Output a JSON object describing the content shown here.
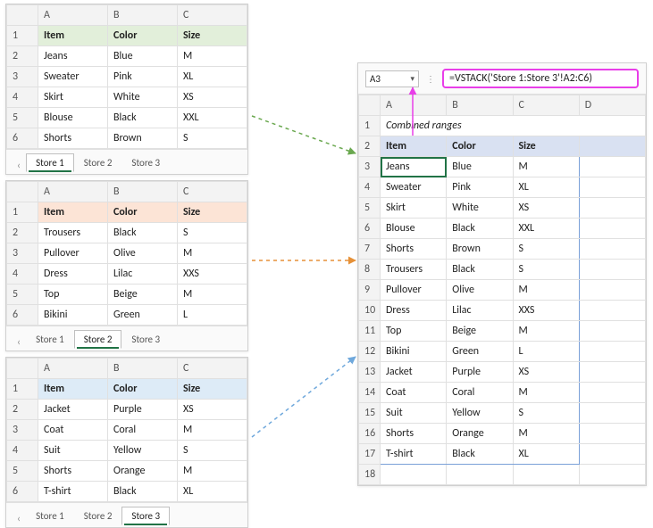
{
  "chart_data": {
    "type": "table",
    "formula": "=VSTACK('Store 1:Store 3'!A2:C6)",
    "active_cell": "A3",
    "columns": [
      "Item",
      "Color",
      "Size"
    ],
    "sheets": [
      {
        "name": "Store 1",
        "rows": [
          [
            "Jeans",
            "Blue",
            "M"
          ],
          [
            "Sweater",
            "Pink",
            "XL"
          ],
          [
            "Skirt",
            "White",
            "XS"
          ],
          [
            "Blouse",
            "Black",
            "XXL"
          ],
          [
            "Shorts",
            "Brown",
            "S"
          ]
        ]
      },
      {
        "name": "Store 2",
        "rows": [
          [
            "Trousers",
            "Black",
            "S"
          ],
          [
            "Pullover",
            "Olive",
            "M"
          ],
          [
            "Dress",
            "Lilac",
            "XXS"
          ],
          [
            "Top",
            "Beige",
            "M"
          ],
          [
            "Bikini",
            "Green",
            "L"
          ]
        ]
      },
      {
        "name": "Store 3",
        "rows": [
          [
            "Jacket",
            "Purple",
            "XS"
          ],
          [
            "Coat",
            "Coral",
            "M"
          ],
          [
            "Suit",
            "Yellow",
            "S"
          ],
          [
            "Shorts",
            "Orange",
            "M"
          ],
          [
            "T-shirt",
            "Black",
            "XL"
          ]
        ]
      }
    ],
    "combined_title": "Combined ranges",
    "combined_rows": [
      [
        "Jeans",
        "Blue",
        "M"
      ],
      [
        "Sweater",
        "Pink",
        "XL"
      ],
      [
        "Skirt",
        "White",
        "XS"
      ],
      [
        "Blouse",
        "Black",
        "XXL"
      ],
      [
        "Shorts",
        "Brown",
        "S"
      ],
      [
        "Trousers",
        "Black",
        "S"
      ],
      [
        "Pullover",
        "Olive",
        "M"
      ],
      [
        "Dress",
        "Lilac",
        "XXS"
      ],
      [
        "Top",
        "Beige",
        "M"
      ],
      [
        "Bikini",
        "Green",
        "L"
      ],
      [
        "Jacket",
        "Purple",
        "XS"
      ],
      [
        "Coat",
        "Coral",
        "M"
      ],
      [
        "Suit",
        "Yellow",
        "S"
      ],
      [
        "Shorts",
        "Orange",
        "M"
      ],
      [
        "T-shirt",
        "Black",
        "XL"
      ]
    ]
  },
  "p1": {
    "h_item": "Item",
    "h_color": "Color",
    "h_size": "Size",
    "r1c1": "Jeans",
    "r1c2": "Blue",
    "r1c3": "M",
    "r2c1": "Sweater",
    "r2c2": "Pink",
    "r2c3": "XL",
    "r3c1": "Skirt",
    "r3c2": "White",
    "r3c3": "XS",
    "r4c1": "Blouse",
    "r4c2": "Black",
    "r4c3": "XXL",
    "r5c1": "Shorts",
    "r5c2": "Brown",
    "r5c3": "S",
    "tab1": "Store 1",
    "tab2": "Store 2",
    "tab3": "Store 3"
  },
  "p2": {
    "h_item": "Item",
    "h_color": "Color",
    "h_size": "Size",
    "r1c1": "Trousers",
    "r1c2": "Black",
    "r1c3": "S",
    "r2c1": "Pullover",
    "r2c2": "Olive",
    "r2c3": "M",
    "r3c1": "Dress",
    "r3c2": "Lilac",
    "r3c3": "XXS",
    "r4c1": "Top",
    "r4c2": "Beige",
    "r4c3": "M",
    "r5c1": "Bikini",
    "r5c2": "Green",
    "r5c3": "L",
    "tab1": "Store 1",
    "tab2": "Store 2",
    "tab3": "Store 3"
  },
  "p3": {
    "h_item": "Item",
    "h_color": "Color",
    "h_size": "Size",
    "r1c1": "Jacket",
    "r1c2": "Purple",
    "r1c3": "XS",
    "r2c1": "Coat",
    "r2c2": "Coral",
    "r2c3": "M",
    "r3c1": "Suit",
    "r3c2": "Yellow",
    "r3c3": "S",
    "r4c1": "Shorts",
    "r4c2": "Orange",
    "r4c3": "M",
    "r5c1": "T-shirt",
    "r5c2": "Black",
    "r5c3": "XL",
    "tab1": "Store 1",
    "tab2": "Store 2",
    "tab3": "Store 3"
  },
  "comb": {
    "cell_ref": "A3",
    "formula": "=VSTACK('Store 1:Store 3'!A2:C6)",
    "title": "Combined ranges",
    "h_item": "Item",
    "h_color": "Color",
    "h_size": "Size",
    "r1c1": "Jeans",
    "r1c2": "Blue",
    "r1c3": "M",
    "r2c1": "Sweater",
    "r2c2": "Pink",
    "r2c3": "XL",
    "r3c1": "Skirt",
    "r3c2": "White",
    "r3c3": "XS",
    "r4c1": "Blouse",
    "r4c2": "Black",
    "r4c3": "XXL",
    "r5c1": "Shorts",
    "r5c2": "Brown",
    "r5c3": "S",
    "r6c1": "Trousers",
    "r6c2": "Black",
    "r6c3": "S",
    "r7c1": "Pullover",
    "r7c2": "Olive",
    "r7c3": "M",
    "r8c1": "Dress",
    "r8c2": "Lilac",
    "r8c3": "XXS",
    "r9c1": "Top",
    "r9c2": "Beige",
    "r9c3": "M",
    "r10c1": "Bikini",
    "r10c2": "Green",
    "r10c3": "L",
    "r11c1": "Jacket",
    "r11c2": "Purple",
    "r11c3": "XS",
    "r12c1": "Coat",
    "r12c2": "Coral",
    "r12c3": "M",
    "r13c1": "Suit",
    "r13c2": "Yellow",
    "r13c3": "S",
    "r14c1": "Shorts",
    "r14c2": "Orange",
    "r14c3": "M",
    "r15c1": "T-shirt",
    "r15c2": "Black",
    "r15c3": "XL"
  },
  "colhdr": {
    "A": "A",
    "B": "B",
    "C": "C",
    "D": "D"
  },
  "rowhdr": {
    "n1": "1",
    "n2": "2",
    "n3": "3",
    "n4": "4",
    "n5": "5",
    "n6": "6",
    "n7": "7",
    "n8": "8",
    "n9": "9",
    "n10": "10",
    "n11": "11",
    "n12": "12",
    "n13": "13",
    "n14": "14",
    "n15": "15",
    "n16": "16",
    "n17": "17",
    "n18": "18"
  }
}
